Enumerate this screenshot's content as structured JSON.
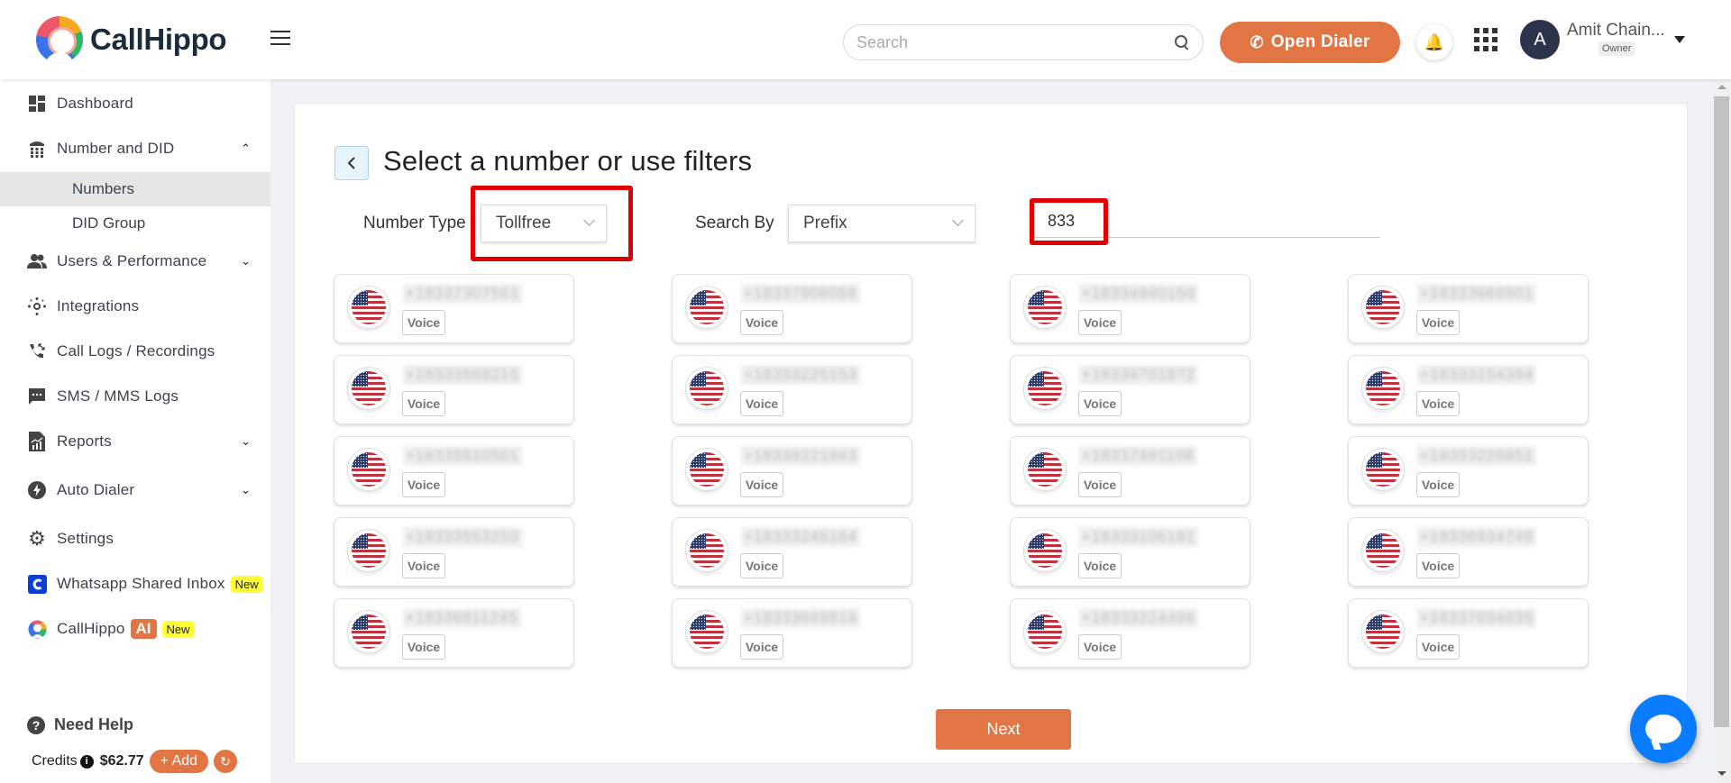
{
  "header": {
    "brand": "CallHippo",
    "search_placeholder": "Search",
    "open_dialer_label": "Open Dialer",
    "user": {
      "initial": "A",
      "name": "Amit Chain...",
      "role": "Owner"
    }
  },
  "sidebar": {
    "items": [
      {
        "label": "Dashboard",
        "icon": "dashboard-icon"
      },
      {
        "label": "Number and DID",
        "icon": "phone-grid-icon",
        "expanded": true,
        "children": [
          {
            "label": "Numbers",
            "active": true
          },
          {
            "label": "DID Group"
          }
        ]
      },
      {
        "label": "Users & Performance",
        "icon": "users-icon",
        "expandable": true
      },
      {
        "label": "Integrations",
        "icon": "integrations-icon"
      },
      {
        "label": "Call Logs / Recordings",
        "icon": "call-logs-icon"
      },
      {
        "label": "SMS / MMS Logs",
        "icon": "sms-icon"
      },
      {
        "label": "Reports",
        "icon": "reports-icon",
        "expandable": true
      },
      {
        "label": "Auto Dialer",
        "icon": "bolt-icon",
        "expandable": true
      },
      {
        "label": "Settings",
        "icon": "gear-icon"
      },
      {
        "label": "Whatsapp Shared Inbox",
        "icon": "whatsapp-inbox-icon",
        "badge": "New"
      },
      {
        "label": "CallHippo",
        "icon": "callhippo-logo-icon",
        "ai_badge": "AI",
        "badge": "New"
      }
    ],
    "help_label": "Need Help",
    "credits_label": "Credits",
    "credits_value": "$62.77",
    "add_label": "+ Add"
  },
  "main": {
    "title": "Select a number or use filters",
    "filters": {
      "number_type_label": "Number Type",
      "number_type_value": "Tollfree",
      "search_by_label": "Search By",
      "search_by_value": "Prefix",
      "prefix_value": "833"
    },
    "numbers": [
      {
        "number": "+18337307561",
        "type": "Voice"
      },
      {
        "number": "+18337808058",
        "type": "Voice"
      },
      {
        "number": "+18334940150",
        "type": "Voice"
      },
      {
        "number": "+18333669501",
        "type": "Voice"
      },
      {
        "number": "+18333669215",
        "type": "Voice"
      },
      {
        "number": "+18333225153",
        "type": "Voice"
      },
      {
        "number": "+18339701872",
        "type": "Voice"
      },
      {
        "number": "+18333154394",
        "type": "Voice"
      },
      {
        "number": "+18335810501",
        "type": "Voice"
      },
      {
        "number": "+18339221943",
        "type": "Voice"
      },
      {
        "number": "+18337491106",
        "type": "Voice"
      },
      {
        "number": "+18333226851",
        "type": "Voice"
      },
      {
        "number": "+18333553250",
        "type": "Voice"
      },
      {
        "number": "+18333246164",
        "type": "Voice"
      },
      {
        "number": "+18333106191",
        "type": "Voice"
      },
      {
        "number": "+18336934746",
        "type": "Voice"
      },
      {
        "number": "+18336811245",
        "type": "Voice"
      },
      {
        "number": "+18333669819",
        "type": "Voice"
      },
      {
        "number": "+18333224496",
        "type": "Voice"
      },
      {
        "number": "+18337034035",
        "type": "Voice"
      }
    ],
    "next_label": "Next"
  },
  "colors": {
    "accent": "#e27544",
    "highlight": "#e00000",
    "chat": "#0a7cff",
    "new_badge": "#ffff36"
  }
}
